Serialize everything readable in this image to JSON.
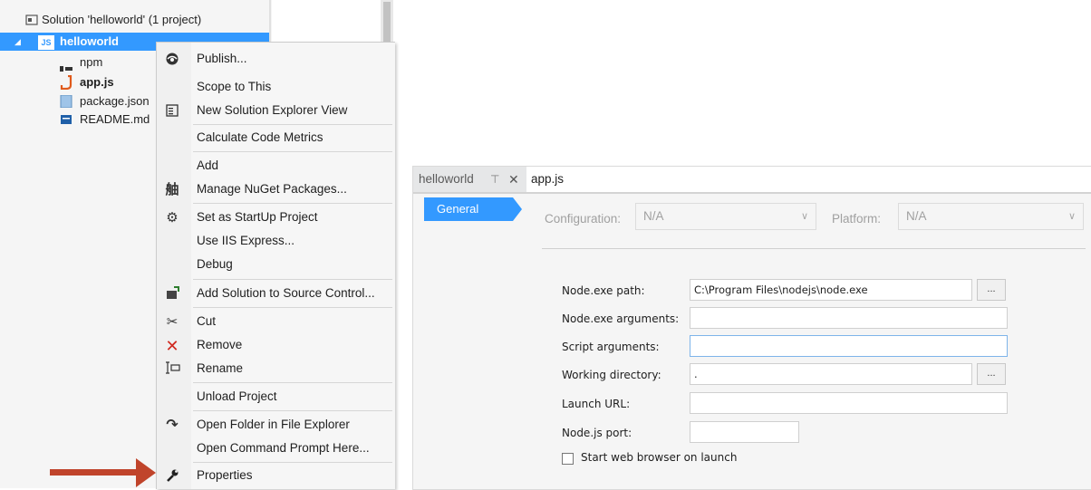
{
  "explorer": {
    "solution_label": "Solution 'helloworld' (1 project)",
    "project_label": "helloworld",
    "project_badge": "JS",
    "items": [
      {
        "label": "npm",
        "icon": "npm-icon"
      },
      {
        "label": "app.js",
        "icon": "js-file-icon"
      },
      {
        "label": "package.json",
        "icon": "json-file-icon"
      },
      {
        "label": "README.md",
        "icon": "markdown-file-icon"
      }
    ]
  },
  "context_menu": {
    "items": [
      {
        "label": "Publish...",
        "icon": "publish-icon"
      },
      {
        "label": "Scope to This"
      },
      {
        "label": "New Solution Explorer View",
        "icon": "new-view-icon"
      },
      {
        "label": "Calculate Code Metrics"
      },
      {
        "label": "Add"
      },
      {
        "label": "Manage NuGet Packages...",
        "icon": "nuget-icon"
      },
      {
        "label": "Set as StartUp Project",
        "icon": "gear-icon"
      },
      {
        "label": "Use IIS Express..."
      },
      {
        "label": "Debug"
      },
      {
        "label": "Add Solution to Source Control...",
        "icon": "source-control-icon"
      },
      {
        "label": "Cut",
        "icon": "scissors-icon"
      },
      {
        "label": "Remove",
        "icon": "remove-icon"
      },
      {
        "label": "Rename",
        "icon": "rename-icon"
      },
      {
        "label": "Unload Project"
      },
      {
        "label": "Open Folder in File Explorer",
        "icon": "open-folder-icon"
      },
      {
        "label": "Open Command Prompt Here..."
      },
      {
        "label": "Properties",
        "icon": "wrench-icon"
      }
    ]
  },
  "properties_window": {
    "tabs": [
      {
        "label": "helloworld",
        "active": true
      },
      {
        "label": "app.js",
        "active": false
      }
    ],
    "nav": {
      "general": "General"
    },
    "configuration": {
      "label": "Configuration:",
      "value": "N/A"
    },
    "platform": {
      "label": "Platform:",
      "value": "N/A"
    },
    "fields": {
      "node_path": {
        "label": "Node.exe path:",
        "value": "C:\\Program Files\\nodejs\\node.exe",
        "button": "..."
      },
      "node_args": {
        "label": "Node.exe arguments:",
        "value": ""
      },
      "script_args": {
        "label": "Script arguments:",
        "value": ""
      },
      "working_dir": {
        "label": "Working directory:",
        "value": ".",
        "button": "..."
      },
      "launch_url": {
        "label": "Launch URL:",
        "value": ""
      },
      "node_port": {
        "label": "Node.js port:",
        "value": ""
      }
    },
    "start_browser": {
      "label": "Start web browser on launch",
      "checked": false
    }
  },
  "colors": {
    "selection": "#3399ff",
    "arrow": "#c0442b"
  }
}
